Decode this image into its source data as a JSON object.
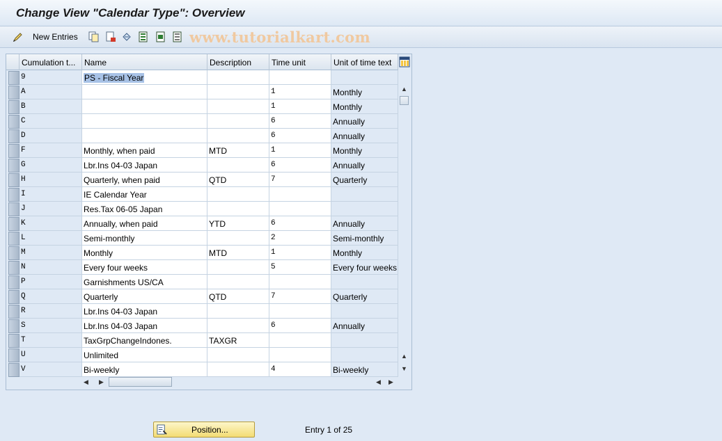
{
  "window": {
    "title": "Change View \"Calendar Type\": Overview"
  },
  "toolbar": {
    "new_entries_label": "New Entries",
    "watermark": "www.tutorialkart.com",
    "icons": [
      "edit-pencil-icon",
      "copy-icon",
      "delete-icon",
      "undo-icon",
      "select-all-icon",
      "select-block-icon",
      "deselect-icon"
    ]
  },
  "table": {
    "columns": [
      "Cumulation t...",
      "Name",
      "Description",
      "Time unit",
      "Unit of time text"
    ],
    "rows": [
      {
        "key": "9",
        "name": "PS - Fiscal Year",
        "desc": "",
        "unit": "",
        "text": ""
      },
      {
        "key": "A",
        "name": "",
        "desc": "",
        "unit": "1",
        "text": "Monthly"
      },
      {
        "key": "B",
        "name": "",
        "desc": "",
        "unit": "1",
        "text": "Monthly"
      },
      {
        "key": "C",
        "name": "",
        "desc": "",
        "unit": "6",
        "text": "Annually"
      },
      {
        "key": "D",
        "name": "",
        "desc": "",
        "unit": "6",
        "text": "Annually"
      },
      {
        "key": "F",
        "name": "Monthly, when paid",
        "desc": "MTD",
        "unit": "1",
        "text": "Monthly"
      },
      {
        "key": "G",
        "name": "Lbr.Ins 04-03  Japan",
        "desc": "",
        "unit": "6",
        "text": "Annually"
      },
      {
        "key": "H",
        "name": "Quarterly, when paid",
        "desc": "QTD",
        "unit": "7",
        "text": "Quarterly"
      },
      {
        "key": "I",
        "name": "IE Calendar Year",
        "desc": "",
        "unit": "",
        "text": ""
      },
      {
        "key": "J",
        "name": "Res.Tax 06-05  Japan",
        "desc": "",
        "unit": "",
        "text": ""
      },
      {
        "key": "K",
        "name": "Annually, when paid",
        "desc": "YTD",
        "unit": "6",
        "text": "Annually"
      },
      {
        "key": "L",
        "name": "Semi-monthly",
        "desc": "",
        "unit": "2",
        "text": "Semi-monthly"
      },
      {
        "key": "M",
        "name": "Monthly",
        "desc": "MTD",
        "unit": "1",
        "text": "Monthly"
      },
      {
        "key": "N",
        "name": "Every four weeks",
        "desc": "",
        "unit": "5",
        "text": "Every four weeks"
      },
      {
        "key": "P",
        "name": "Garnishments US/CA",
        "desc": "",
        "unit": "",
        "text": ""
      },
      {
        "key": "Q",
        "name": "Quarterly",
        "desc": "QTD",
        "unit": "7",
        "text": "Quarterly"
      },
      {
        "key": "R",
        "name": "Lbr.Ins 04-03  Japan",
        "desc": "",
        "unit": "",
        "text": ""
      },
      {
        "key": "S",
        "name": "Lbr.Ins 04-03  Japan",
        "desc": "",
        "unit": "6",
        "text": "Annually"
      },
      {
        "key": "T",
        "name": "TaxGrpChangeIndones.",
        "desc": "TAXGR",
        "unit": "",
        "text": ""
      },
      {
        "key": "U",
        "name": "Unlimited",
        "desc": "",
        "unit": "",
        "text": ""
      },
      {
        "key": "V",
        "name": "Bi-weekly",
        "desc": "",
        "unit": "4",
        "text": "Bi-weekly"
      }
    ]
  },
  "footer": {
    "position_button": "Position...",
    "entry_info": "Entry 1 of 25"
  }
}
